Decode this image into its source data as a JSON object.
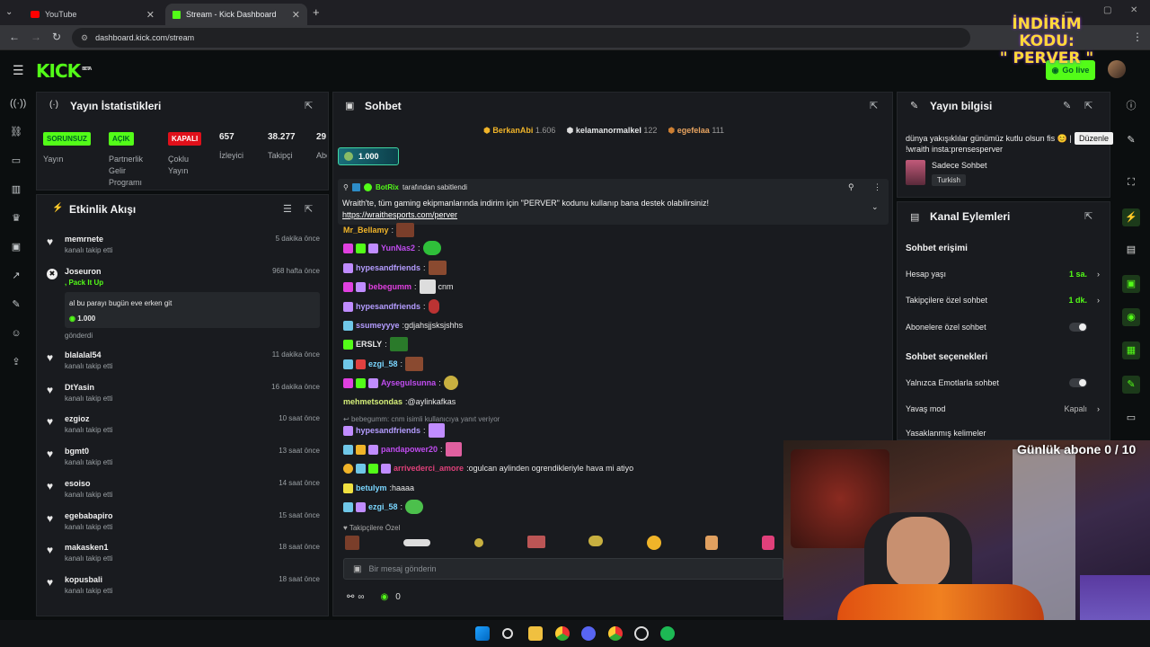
{
  "browser": {
    "tabs": [
      {
        "label": "YouTube"
      },
      {
        "label": "Stream - Kick Dashboard"
      }
    ],
    "url": "dashboard.kick.com/stream",
    "overlay_promo_line1": "İNDİRİM KODU:",
    "overlay_promo_line2": "\" PERVER \""
  },
  "header": {
    "logo": "KICK",
    "logo_sup": "BETA",
    "go_live": "Go live"
  },
  "stats": {
    "title": "Yayın İstatistikleri",
    "items": [
      {
        "badge": "SORUNSUZ",
        "label": "Yayın"
      },
      {
        "badge": "AÇIK",
        "label": "Partnerlik Gelir Programı"
      },
      {
        "badge": "KAPALI",
        "label": "Çoklu Yayın"
      },
      {
        "value": "657",
        "label": "İzleyici"
      },
      {
        "value": "38.277",
        "label": "Takipçi"
      },
      {
        "value": "29",
        "label": "Abo"
      }
    ],
    "colors": {
      "green": "#53fc18",
      "red": "#e0101a"
    }
  },
  "activity": {
    "title": "Etkinlik Akışı",
    "rows": [
      {
        "name": "memrnete",
        "sub": "kanalı takip etti",
        "time": "5 dakika önce"
      },
      {
        "name": "Joseuron",
        "sub": ", Pack It Up",
        "time": "968 hafta önce",
        "message": "al bu parayı bugün eve erken git",
        "amount": "1.000",
        "footer": "gönderdi"
      },
      {
        "name": "blalalal54",
        "sub": "kanalı takip etti",
        "time": "11 dakika önce"
      },
      {
        "name": "DtYasin",
        "sub": "kanalı takip etti",
        "time": "16 dakika önce"
      },
      {
        "name": "ezgioz",
        "sub": "kanalı takip etti",
        "time": "10 saat önce"
      },
      {
        "name": "bgmt0",
        "sub": "kanalı takip etti",
        "time": "13 saat önce"
      },
      {
        "name": "esoiso",
        "sub": "kanalı takip etti",
        "time": "14 saat önce"
      },
      {
        "name": "egebabapiro",
        "sub": "kanalı takip etti",
        "time": "15 saat önce"
      },
      {
        "name": "makasken1",
        "sub": "kanalı takip etti",
        "time": "18 saat önce"
      },
      {
        "name": "kopusbali",
        "sub": "kanalı takip etti",
        "time": "18 saat önce"
      }
    ]
  },
  "chat": {
    "title": "Sohbet",
    "leaders": [
      {
        "name": "BerkanAbi",
        "count": "1.606"
      },
      {
        "name": "kelamanormalkel",
        "count": "122"
      },
      {
        "name": "egefelaa",
        "count": "111"
      }
    ],
    "gift_amount": "1.000",
    "pinned": {
      "by_user": "BotRix",
      "by_text": "tarafından sabitlendi",
      "text": "Wraith'te, tüm gaming ekipmanlarında indirim için \"PERVER\" kodunu kullanıp bana destek olabilirsiniz!",
      "link": "https://wraithesports.com/perver"
    },
    "messages": [
      {
        "user": "Mr_Bellamy",
        "text": "",
        "color": "#f0b429"
      },
      {
        "user": "YunNas2",
        "text": "",
        "color": "#c04cf0"
      },
      {
        "user": "hypesandfriends",
        "text": "",
        "color": "#b49cff"
      },
      {
        "user": "bebegumm",
        "text": "cnm",
        "color": "#e040e0"
      },
      {
        "user": "hypesandfriends",
        "text": "",
        "color": "#b49cff"
      },
      {
        "user": "ssumeyyye",
        "text": "gdjahsjjsksjshhs",
        "color": "#b49cff"
      },
      {
        "user": "ERSLY",
        "text": "",
        "color": "#e8e8e8"
      },
      {
        "user": "ezgi_58",
        "text": "",
        "color": "#7ad6ff"
      },
      {
        "user": "Aysegulsunna",
        "text": "",
        "color": "#c04cf0"
      },
      {
        "user": "mehmetsondas",
        "text": "@aylinkafkas",
        "color": "#d6f07a"
      },
      {
        "user": "hypesandfriends",
        "text": "",
        "color": "#b49cff",
        "reply": "bebegumm: cnm isimli kullanıcıya yanıt veriyor"
      },
      {
        "user": "pandapower20",
        "text": "",
        "color": "#c04cf0"
      },
      {
        "user": "arrivederci_amore",
        "text": "ogulcan aylinden ogrendikleriyle hava mi atiyo",
        "color": "#e0407a"
      },
      {
        "user": "betulym",
        "text": "haaaa",
        "color": "#7ad6ff"
      },
      {
        "user": "ezgi_58",
        "text": "",
        "color": "#7ad6ff"
      }
    ],
    "followers_only_label": "Takipçilere Özel",
    "input_placeholder": "Bir mesaj gönderin",
    "points": "0",
    "infinity": "∞"
  },
  "stream_info": {
    "title": "Yayın bilgisi",
    "text": "dünya yakışıklılar günümüz kutlu olsun fis 😊 | !wraith insta:prensesperver",
    "tooltip": "Düzenle",
    "category": "Sadece Sohbet",
    "language": "Turkish"
  },
  "channel_actions": {
    "title": "Kanal Eylemleri",
    "access_title": "Sohbet erişimi",
    "account_age": {
      "label": "Hesap yaşı",
      "value": "1 sa."
    },
    "followers_only": {
      "label": "Takipçilere özel sohbet",
      "value": "1 dk."
    },
    "subs_only": {
      "label": "Abonelere özel sohbet"
    },
    "options_title": "Sohbet seçenekleri",
    "emote_only": {
      "label": "Yalnızca Emotlarla sohbet"
    },
    "slow_mode": {
      "label": "Yavaş mod",
      "value": "Kapalı"
    },
    "banned_words": {
      "label": "Yasaklanmış kelimeler"
    }
  },
  "overlay": {
    "daily_subs": "Günlük abone 0 / 10"
  }
}
